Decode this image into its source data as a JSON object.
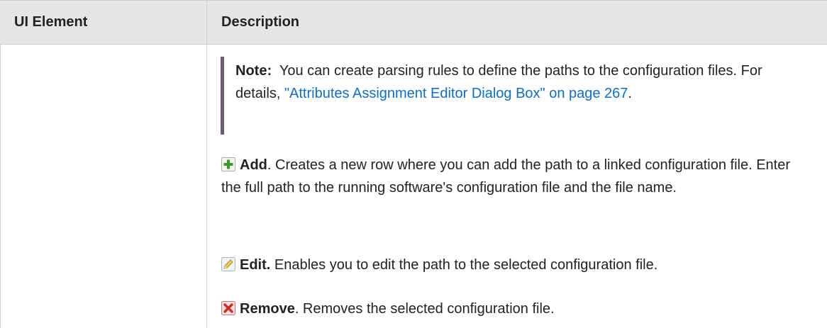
{
  "table": {
    "headers": [
      "UI Element",
      "Description"
    ]
  },
  "note": {
    "label": "Note:",
    "text_before_link": "You can create parsing rules to define the paths to the configuration files. For details, ",
    "link_text": "\"Attributes Assignment Editor Dialog Box\" on page 267",
    "text_after_link": "."
  },
  "items": [
    {
      "icon": "add-icon",
      "name": "Add",
      "description": ". Creates a new row where you can add the path to a linked configuration file. Enter the full path to the running software's configuration file and the file name."
    },
    {
      "icon": "edit-icon",
      "name": "Edit.",
      "description": " Enables you to edit the path to the selected configuration file."
    },
    {
      "icon": "remove-icon",
      "name": "Remove",
      "description": ". Removes the selected configuration file."
    }
  ],
  "colors": {
    "header_bg": "#e6e6e6",
    "link": "#0a6fc7",
    "note_bar": "#6b5b73"
  }
}
